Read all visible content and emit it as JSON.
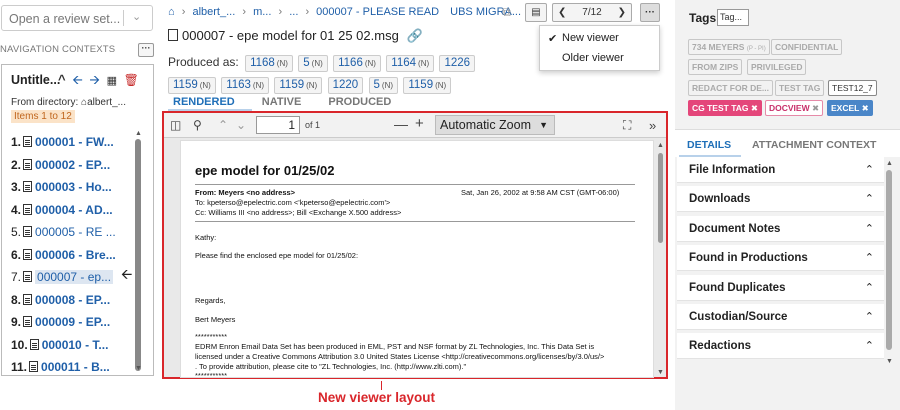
{
  "left": {
    "review_placeholder": "Open a review set...",
    "nav_label": "NAVIGATION CONTEXTS",
    "context_title": "Untitle...",
    "from_dir": "From directory: ",
    "from_dir_path": "albert_...",
    "items_badge": "Items 1 to 12",
    "dots": "···",
    "rows": [
      {
        "num": "1.",
        "label": "000001 - FW..."
      },
      {
        "num": "2.",
        "label": "000002 - EP..."
      },
      {
        "num": "3.",
        "label": "000003 - Ho..."
      },
      {
        "num": "4.",
        "label": "000004 - AD..."
      },
      {
        "num": "5.",
        "label": "000005 - RE ..."
      },
      {
        "num": "6.",
        "label": "000006 - Bre..."
      },
      {
        "num": "7.",
        "label": "000007 - ep..."
      },
      {
        "num": "8.",
        "label": "000008 - EP..."
      },
      {
        "num": "9.",
        "label": "000009 - EP..."
      },
      {
        "num": "10.",
        "label": "000010 - T..."
      },
      {
        "num": "11.",
        "label": "000011 - B..."
      }
    ]
  },
  "center": {
    "crumbs": [
      "albert_...",
      "m...",
      "...",
      "000007 - PLEASE READ",
      "UBS MIGRA..."
    ],
    "pager": "7/12",
    "doc_title": "000007 - epe model for 01 25 02.msg",
    "produced_label": "Produced as:",
    "produced": [
      {
        "v": "1168",
        "n": "(N)"
      },
      {
        "v": "5",
        "n": "(N)"
      },
      {
        "v": "1166",
        "n": "(N)"
      },
      {
        "v": "1164",
        "n": "(N)"
      },
      {
        "v": "1226",
        "n": ""
      },
      {
        "v": "1159",
        "n": "(N)"
      },
      {
        "v": "1163",
        "n": "(N)"
      },
      {
        "v": "1159",
        "n": "(N)"
      },
      {
        "v": "1220",
        "n": ""
      },
      {
        "v": "5",
        "n": "(N)"
      },
      {
        "v": "1159",
        "n": "(N)"
      }
    ],
    "tabs": {
      "rendered": "RENDERED",
      "native": "NATIVE",
      "produced": "PRODUCED"
    },
    "pdf": {
      "page": "1",
      "of": "of 1",
      "zoom": "Automatic Zoom"
    },
    "email": {
      "subject": "epe model for 01/25/02",
      "from_label": "From:",
      "from_value": "Meyers <no address>",
      "date": "Sat, Jan 26, 2002 at 9:58 AM CST (GMT-06:00)",
      "to": "To: kpeterso@epelectric.com <'kpeterso@epelectric.com'>",
      "cc": "Cc: Williams III <no address>; Bill <Exchange X.500 address>",
      "greeting": "Kathy:",
      "body1": "Please find the enclosed epe model for 01/25/02:",
      "regards": "Regards,",
      "name": "Bert Meyers",
      "stars": "***********",
      "edrm1": "EDRM Enron Email Data Set has been produced in EML, PST and NSF format by ZL Technologies, Inc. This Data Set is",
      "edrm2": "licensed under a Creative Commons Attribution 3.0 United States License <http://creativecommons.org/licenses/by/3.0/us/>",
      "edrm3": ". To provide attribution, please cite to \"ZL Technologies, Inc. (http://www.zlti.com).\"",
      "stars2": "***********"
    },
    "annotation": "New viewer layout"
  },
  "dropdown": {
    "new_viewer": "New viewer",
    "older_viewer": "Older viewer"
  },
  "right": {
    "tags_label": "Tags",
    "tag_input_placeholder": "Tag...",
    "tags": [
      {
        "label": "734 MEYERS",
        "sub": "(P - PI)"
      },
      {
        "label": "CONFIDENTIAL"
      },
      {
        "label": "FROM ZIPS"
      },
      {
        "label": "PRIVILEGED"
      },
      {
        "label": "REDACT FOR DE..."
      },
      {
        "label": "TEST TAG"
      },
      {
        "label": "TEST12_7"
      },
      {
        "label": "CG TEST TAG",
        "x": "✖"
      },
      {
        "label": "DOCVIEW",
        "x": "✖"
      },
      {
        "label": "EXCEL",
        "x": "✖"
      }
    ],
    "tab_details": "DETAILS",
    "tab_attach": "ATTACHMENT CONTEXT",
    "accordions": [
      "File Information",
      "Downloads",
      "Document Notes",
      "Found in Productions",
      "Found Duplicates",
      "Custodian/Source",
      "Redactions"
    ]
  },
  "colors": {
    "accent": "#1f5fa8",
    "annotation": "#d9262b",
    "tag_red": "#e4467a",
    "tag_blue": "#4a86c8"
  }
}
